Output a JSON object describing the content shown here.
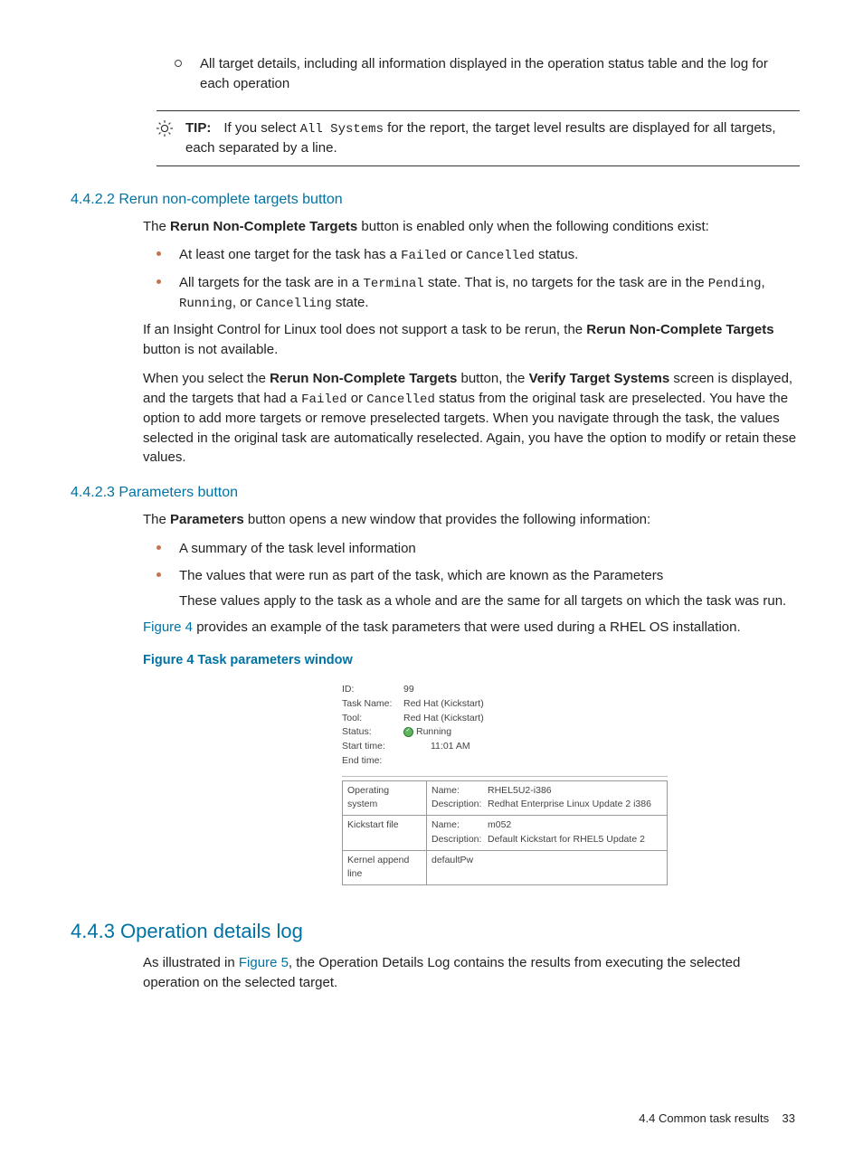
{
  "top_bullet": "All target details, including all information displayed in the operation status table and the log for each operation",
  "tip": {
    "label": "TIP:",
    "before_code": "If you select ",
    "code": "All Systems",
    "after_code": " for the report, the target level results are displayed for all targets, each separated by a line."
  },
  "sec_4422": {
    "heading": "4.4.2.2 Rerun non-complete targets button",
    "p1_a": "The ",
    "p1_bold": "Rerun Non-Complete Targets",
    "p1_b": " button is enabled only when the following conditions exist:",
    "b1_a": "At least one target for the task has a ",
    "b1_code1": "Failed",
    "b1_mid": " or ",
    "b1_code2": "Cancelled",
    "b1_b": " status.",
    "b2_a": "All targets for the task are in a ",
    "b2_code1": "Terminal",
    "b2_b": " state. That is, no targets for the task are in the ",
    "b2_code2": "Pending",
    "b2_c": ", ",
    "b2_code3": "Running",
    "b2_d": ", or ",
    "b2_code4": "Cancelling",
    "b2_e": " state.",
    "p2_a": "If an Insight Control for Linux tool does not support a task to be rerun, the ",
    "p2_bold": "Rerun Non-Complete Targets",
    "p2_b": " button is not available.",
    "p3_a": "When you select the ",
    "p3_bold1": "Rerun Non-Complete Targets",
    "p3_b": " button, the ",
    "p3_bold2": "Verify Target Systems",
    "p3_c": " screen is displayed, and the targets that had a ",
    "p3_code1": "Failed",
    "p3_d": " or ",
    "p3_code2": "Cancelled",
    "p3_e": " status from the original task are preselected. You have the option to add more targets or remove preselected targets. When you navigate through the task, the values selected in the original task are automatically reselected. Again, you have the option to modify or retain these values."
  },
  "sec_4423": {
    "heading": "4.4.2.3 Parameters button",
    "p1_a": "The ",
    "p1_bold": "Parameters",
    "p1_b": " button opens a new window that provides the following information:",
    "b1": "A summary of the task level information",
    "b2": "The values that were run as part of the task, which are known as the Parameters",
    "b2_sub": "These values apply to the task as a whole and are the same for all targets on which the task was run.",
    "p2_link": "Figure 4",
    "p2_rest": " provides an example of the task parameters that were used during a RHEL OS installation.",
    "figcap": "Figure 4 Task parameters window"
  },
  "chart_data": {
    "type": "table",
    "summary_rows": [
      {
        "label": "ID:",
        "value": "99"
      },
      {
        "label": "Task Name:",
        "value": "Red Hat (Kickstart)"
      },
      {
        "label": "Tool:",
        "value": "Red Hat (Kickstart)"
      },
      {
        "label": "Status:",
        "value": "Running",
        "icon": "running"
      },
      {
        "label": "Start time:",
        "value": "11:01 AM"
      },
      {
        "label": "End time:",
        "value": ""
      }
    ],
    "param_rows": [
      {
        "left": "Operating system",
        "name": "RHEL5U2-i386",
        "desc": "Redhat Enterprise Linux Update 2 i386"
      },
      {
        "left": "Kickstart file",
        "name": "m052",
        "desc": "Default Kickstart for RHEL5 Update 2"
      },
      {
        "left": "Kernel append line",
        "plain": "defaultPw"
      }
    ]
  },
  "sec_443": {
    "heading": "4.4.3 Operation details log",
    "p1_a": "As illustrated in ",
    "p1_link": "Figure 5",
    "p1_b": ", the Operation Details Log contains the results from executing the selected operation on the selected target."
  },
  "footer": {
    "section": "4.4 Common task results",
    "page": "33"
  }
}
